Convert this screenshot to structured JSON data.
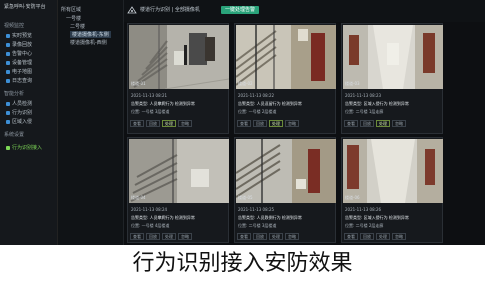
{
  "app": {
    "title": "紧急呼叫·安防平台",
    "view_tab": "楼道行为识别 | 全部摄像机",
    "active_tab": "一键处理告警"
  },
  "sidebar": {
    "sections": [
      {
        "label": "视频监控",
        "top": 0
      },
      {
        "label": "智能分析",
        "top": 0
      },
      {
        "label": "系统设置",
        "top": 0
      }
    ],
    "section_labels": [
      "视频监控",
      "智能分析",
      "系统设置"
    ],
    "items": [
      {
        "label": "实时预览"
      },
      {
        "label": "录像回放"
      },
      {
        "label": "告警中心"
      },
      {
        "label": "设备管理"
      },
      {
        "label": "电子地图"
      },
      {
        "label": "日志查询"
      },
      {
        "label": "人员检测"
      },
      {
        "label": "行为识别"
      },
      {
        "label": "区域入侵"
      },
      {
        "label": "行为识别接入"
      }
    ]
  },
  "tree": {
    "root": "所有区域",
    "level1": "一号楼",
    "level2": "二号楼",
    "cam1": "楼道摄像机-东侧",
    "cam2": "楼道摄像机-西侧"
  },
  "cards": [
    {
      "cam_label": "楼道-01",
      "time": "2021-11-13 08:21",
      "line1": "告警类型: 人员攀爬行为 检测到异常",
      "line2": "位置: 一号楼 3层楼道",
      "buttons": [
        "查看",
        "回放",
        "处理",
        "忽略"
      ]
    },
    {
      "cam_label": "楼道-02",
      "time": "2021-11-13 08:22",
      "line1": "告警类型: 人员逗留行为 检测到异常",
      "line2": "位置: 一号楼 2层楼道",
      "buttons": [
        "查看",
        "回放",
        "处理",
        "忽略"
      ]
    },
    {
      "cam_label": "楼道-03",
      "time": "2021-11-13 08:23",
      "line1": "告警类型: 区域入侵行为 检测到异常",
      "line2": "位置: 二号楼 1层走廊",
      "buttons": [
        "查看",
        "回放",
        "处理",
        "忽略"
      ]
    },
    {
      "cam_label": "楼道-04",
      "time": "2021-11-13 08:24",
      "line1": "告警类型: 人员攀爬行为 检测到异常",
      "line2": "位置: 一号楼 4层楼道",
      "buttons": [
        "查看",
        "回放",
        "处理",
        "忽略"
      ]
    },
    {
      "cam_label": "楼道-05",
      "time": "2021-11-13 08:25",
      "line1": "告警类型: 人员跌倒行为 检测到异常",
      "line2": "位置: 二号楼 3层楼道",
      "buttons": [
        "查看",
        "回放",
        "处理",
        "忽略"
      ]
    },
    {
      "cam_label": "楼道-06",
      "time": "2021-11-13 08:26",
      "line1": "告警类型: 区域入侵行为 检测到异常",
      "line2": "位置: 二号楼 2层走廊",
      "buttons": [
        "查看",
        "回放",
        "处理",
        "忽略"
      ]
    }
  ],
  "caption": "行为识别接入安防效果"
}
